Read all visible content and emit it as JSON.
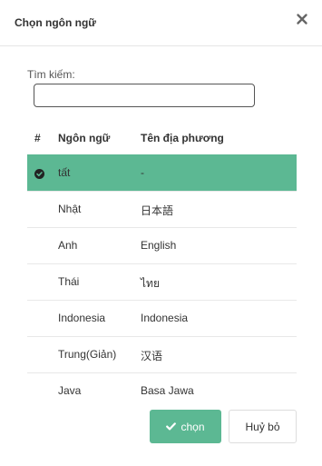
{
  "dialog": {
    "title": "Chọn ngôn ngữ",
    "close_icon": "close-icon"
  },
  "search": {
    "label": "Tìm kiếm:",
    "value": "",
    "placeholder": ""
  },
  "table": {
    "headers": [
      "#",
      "Ngôn ngữ",
      "Tên địa phương"
    ],
    "rows": [
      {
        "language": "tất",
        "local_name": "-",
        "selected": true
      },
      {
        "language": "Nhật",
        "local_name": "日本語",
        "selected": false
      },
      {
        "language": "Anh",
        "local_name": "English",
        "selected": false
      },
      {
        "language": "Thái",
        "local_name": "ไทย",
        "selected": false
      },
      {
        "language": "Indonesia",
        "local_name": "Indonesia",
        "selected": false
      },
      {
        "language": "Trung(Giản)",
        "local_name": "汉语",
        "selected": false
      },
      {
        "language": "Java",
        "local_name": "Basa Jawa",
        "selected": false
      }
    ],
    "selected_icon": "check-circle-icon"
  },
  "actions": {
    "choose_label": "chọn",
    "choose_icon": "check-icon",
    "cancel_label": "Huỷ bỏ"
  },
  "colors": {
    "accent": "#5cb893",
    "text": "#333333",
    "border": "#e5e5e5"
  }
}
